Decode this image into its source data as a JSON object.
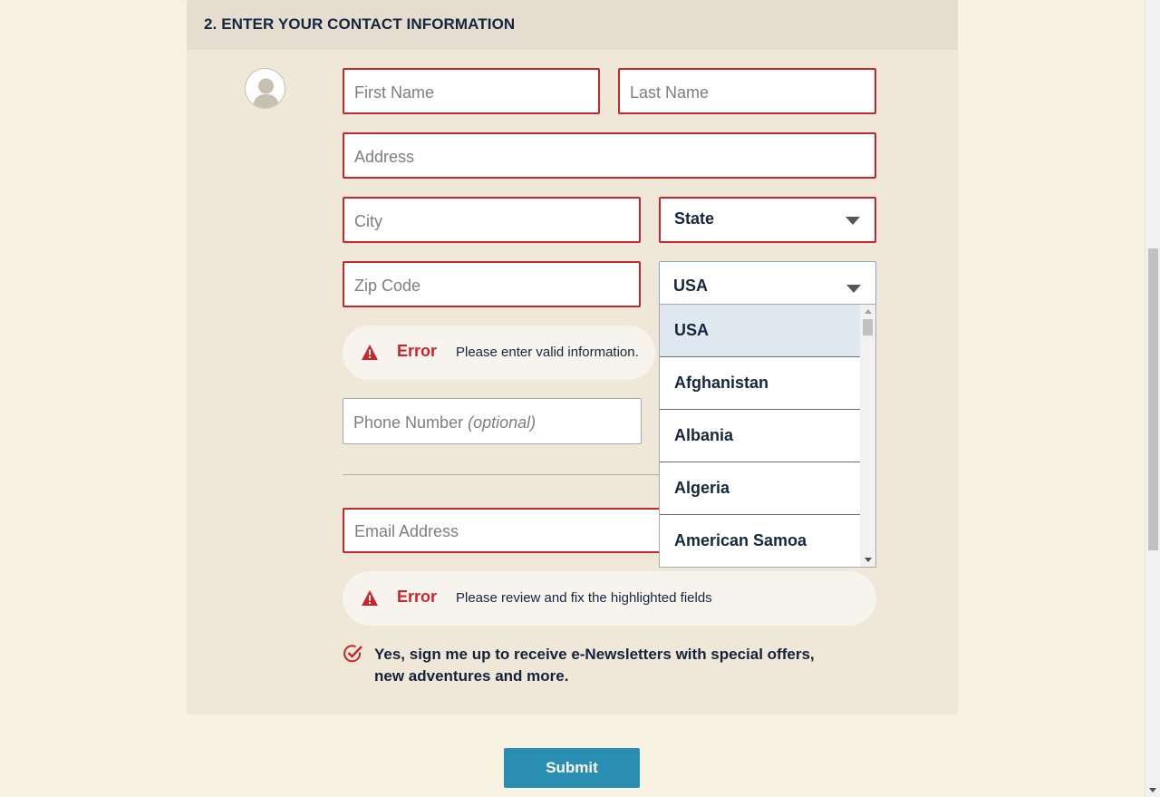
{
  "section": {
    "title": "2. ENTER YOUR CONTACT INFORMATION"
  },
  "form": {
    "first_name_placeholder": "First Name",
    "last_name_placeholder": "Last Name",
    "address_placeholder": "Address",
    "city_placeholder": "City",
    "state_value": "State",
    "zip_placeholder": "Zip Code",
    "country_value": "USA",
    "phone_placeholder": "Phone Number",
    "phone_optional": "(optional)",
    "email_placeholder": "Email Address"
  },
  "country_dropdown": {
    "options": [
      "USA",
      "Afghanistan",
      "Albania",
      "Algeria",
      "American Samoa"
    ],
    "selected": "USA"
  },
  "errors": {
    "label": "Error",
    "location_msg": "Please enter valid information.",
    "form_msg": "Please review and fix the highlighted fields"
  },
  "newsletter": {
    "text": "Yes, sign me up to receive e-Newsletters with special offers, new adventures and more.",
    "checked": true
  },
  "submit_label": "Submit",
  "colors": {
    "background": "#f8f2e3",
    "panel": "#efe7d8",
    "error_red": "#c9252c",
    "submit_blue": "#2a8eb3",
    "text_navy": "#15263f"
  },
  "icons": {
    "avatar": "user-avatar-icon",
    "warning": "warning-icon",
    "check": "check-circle-icon",
    "caret": "caret-down-icon"
  }
}
